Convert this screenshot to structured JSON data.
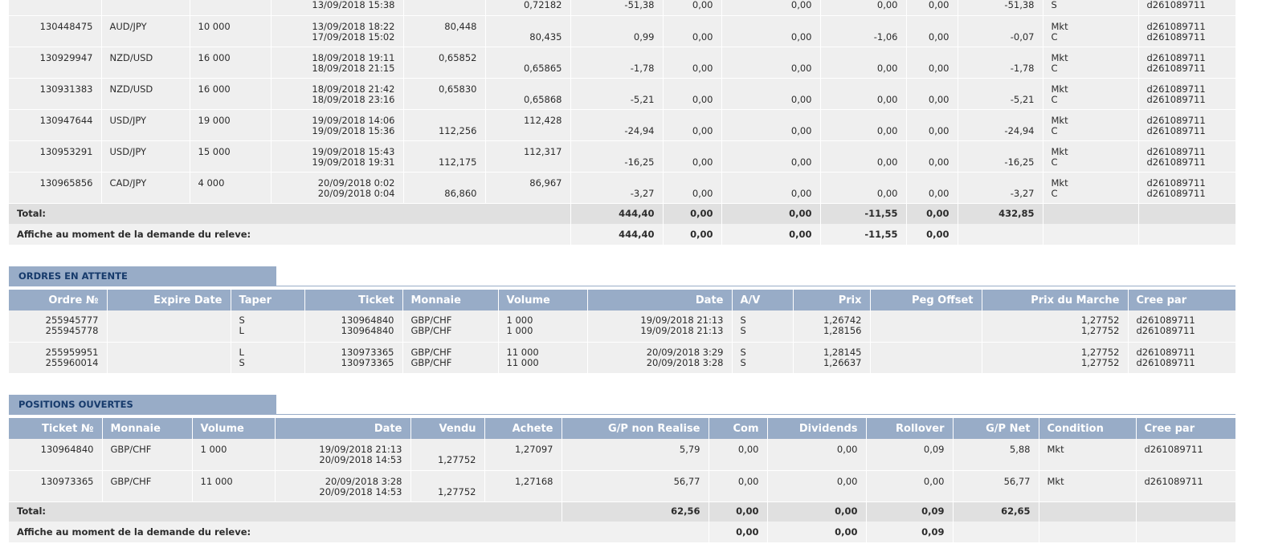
{
  "closed": {
    "rows": [
      {
        "ticket": "",
        "pair": "",
        "volume": "",
        "date1": "",
        "date2": "13/09/2018 15:38",
        "p1": "",
        "p1b": "",
        "p2": "",
        "p2b": "0,72182",
        "gp": "-51,38",
        "com": "0,00",
        "div": "0,00",
        "roll": "0,00",
        "x": "0,00",
        "net": "-51,38",
        "c1": "S",
        "c2": "",
        "by1": "d261089711",
        "by2": ""
      },
      {
        "ticket": "130448475",
        "pair": "AUD/JPY",
        "volume": "10 000",
        "date1": "13/09/2018 18:22",
        "date2": "17/09/2018 15:02",
        "p1": "80,448",
        "p1b": "",
        "p2": "",
        "p2b": "80,435",
        "gp": "0,99",
        "com": "0,00",
        "div": "0,00",
        "roll": "-1,06",
        "x": "0,00",
        "net": "-0,07",
        "c1": "Mkt",
        "c2": "C",
        "by1": "d261089711",
        "by2": "d261089711"
      },
      {
        "ticket": "130929947",
        "pair": "NZD/USD",
        "volume": "16 000",
        "date1": "18/09/2018 19:11",
        "date2": "18/09/2018 21:15",
        "p1": "0,65852",
        "p1b": "",
        "p2": "",
        "p2b": "0,65865",
        "gp": "-1,78",
        "com": "0,00",
        "div": "0,00",
        "roll": "0,00",
        "x": "0,00",
        "net": "-1,78",
        "c1": "Mkt",
        "c2": "C",
        "by1": "d261089711",
        "by2": "d261089711"
      },
      {
        "ticket": "130931383",
        "pair": "NZD/USD",
        "volume": "16 000",
        "date1": "18/09/2018 21:42",
        "date2": "18/09/2018 23:16",
        "p1": "0,65830",
        "p1b": "",
        "p2": "",
        "p2b": "0,65868",
        "gp": "-5,21",
        "com": "0,00",
        "div": "0,00",
        "roll": "0,00",
        "x": "0,00",
        "net": "-5,21",
        "c1": "Mkt",
        "c2": "C",
        "by1": "d261089711",
        "by2": "d261089711"
      },
      {
        "ticket": "130947644",
        "pair": "USD/JPY",
        "volume": "19 000",
        "date1": "19/09/2018 14:06",
        "date2": "19/09/2018 15:36",
        "p1": "",
        "p1b": "112,256",
        "p2": "112,428",
        "p2b": "",
        "gp": "-24,94",
        "com": "0,00",
        "div": "0,00",
        "roll": "0,00",
        "x": "0,00",
        "net": "-24,94",
        "c1": "Mkt",
        "c2": "C",
        "by1": "d261089711",
        "by2": "d261089711"
      },
      {
        "ticket": "130953291",
        "pair": "USD/JPY",
        "volume": "15 000",
        "date1": "19/09/2018 15:43",
        "date2": "19/09/2018 19:31",
        "p1": "",
        "p1b": "112,175",
        "p2": "112,317",
        "p2b": "",
        "gp": "-16,25",
        "com": "0,00",
        "div": "0,00",
        "roll": "0,00",
        "x": "0,00",
        "net": "-16,25",
        "c1": "Mkt",
        "c2": "C",
        "by1": "d261089711",
        "by2": "d261089711"
      },
      {
        "ticket": "130965856",
        "pair": "CAD/JPY",
        "volume": "4 000",
        "date1": "20/09/2018 0:02",
        "date2": "20/09/2018 0:04",
        "p1": "",
        "p1b": "86,860",
        "p2": "86,967",
        "p2b": "",
        "gp": "-3,27",
        "com": "0,00",
        "div": "0,00",
        "roll": "0,00",
        "x": "0,00",
        "net": "-3,27",
        "c1": "Mkt",
        "c2": "C",
        "by1": "d261089711",
        "by2": "d261089711"
      }
    ],
    "total": {
      "label": "Total:",
      "gp": "444,40",
      "com": "0,00",
      "div": "0,00",
      "roll": "-11,55",
      "x": "0,00",
      "net": "432,85"
    },
    "display": {
      "label": "Affiche au moment de la demande du releve:",
      "gp": "444,40",
      "com": "0,00",
      "div": "0,00",
      "roll": "-11,55",
      "x": "0,00"
    }
  },
  "pending": {
    "title": "ORDRES EN ATTENTE",
    "headers": [
      "Ordre №",
      "Expire Date",
      "Taper",
      "Ticket",
      "Monnaie",
      "Volume",
      "Date",
      "A/V",
      "Prix",
      "Peg Offset",
      "Prix du Marche",
      "Cree par"
    ],
    "rows": [
      {
        "order1": "255945777",
        "order2": "255945778",
        "expire": "",
        "type1": "S",
        "type2": "L",
        "ticket1": "130964840",
        "ticket2": "130964840",
        "pair1": "GBP/CHF",
        "pair2": "GBP/CHF",
        "vol1": "1 000",
        "vol2": "1 000",
        "date1": "19/09/2018 21:13",
        "date2": "19/09/2018 21:13",
        "av1": "S",
        "av2": "S",
        "price1": "1,26742",
        "price2": "1,28156",
        "peg": "",
        "mkt1": "1,27752",
        "mkt2": "1,27752",
        "by1": "d261089711",
        "by2": "d261089711"
      },
      {
        "order1": "255959951",
        "order2": "255960014",
        "expire": "",
        "type1": "L",
        "type2": "S",
        "ticket1": "130973365",
        "ticket2": "130973365",
        "pair1": "GBP/CHF",
        "pair2": "GBP/CHF",
        "vol1": "11 000",
        "vol2": "11 000",
        "date1": "20/09/2018 3:29",
        "date2": "20/09/2018 3:28",
        "av1": "S",
        "av2": "S",
        "price1": "1,28145",
        "price2": "1,26637",
        "peg": "",
        "mkt1": "1,27752",
        "mkt2": "1,27752",
        "by1": "d261089711",
        "by2": "d261089711"
      }
    ]
  },
  "open": {
    "title": "POSITIONS OUVERTES",
    "headers": [
      "Ticket №",
      "Monnaie",
      "Volume",
      "Date",
      "Vendu",
      "Achete",
      "G/P non Realise",
      "Com",
      "Dividends",
      "Rollover",
      "G/P Net",
      "Condition",
      "Cree par"
    ],
    "rows": [
      {
        "ticket": "130964840",
        "pair": "GBP/CHF",
        "volume": "1 000",
        "date1": "19/09/2018 21:13",
        "date2": "20/09/2018 14:53",
        "sold": "1,27752",
        "bought": "1,27097",
        "gp": "5,79",
        "com": "0,00",
        "div": "0,00",
        "roll": "0,09",
        "net": "5,88",
        "cond": "Mkt",
        "by": "d261089711"
      },
      {
        "ticket": "130973365",
        "pair": "GBP/CHF",
        "volume": "11 000",
        "date1": "20/09/2018 3:28",
        "date2": "20/09/2018 14:53",
        "sold": "1,27752",
        "bought": "1,27168",
        "gp": "56,77",
        "com": "0,00",
        "div": "0,00",
        "roll": "0,00",
        "net": "56,77",
        "cond": "Mkt",
        "by": "d261089711"
      }
    ],
    "total": {
      "label": "Total:",
      "gp": "62,56",
      "com": "0,00",
      "div": "0,00",
      "roll": "0,09",
      "net": "62,65"
    },
    "display": {
      "label": "Affiche au moment de la demande du releve:",
      "com": "0,00",
      "div": "0,00",
      "roll": "0,09"
    }
  }
}
